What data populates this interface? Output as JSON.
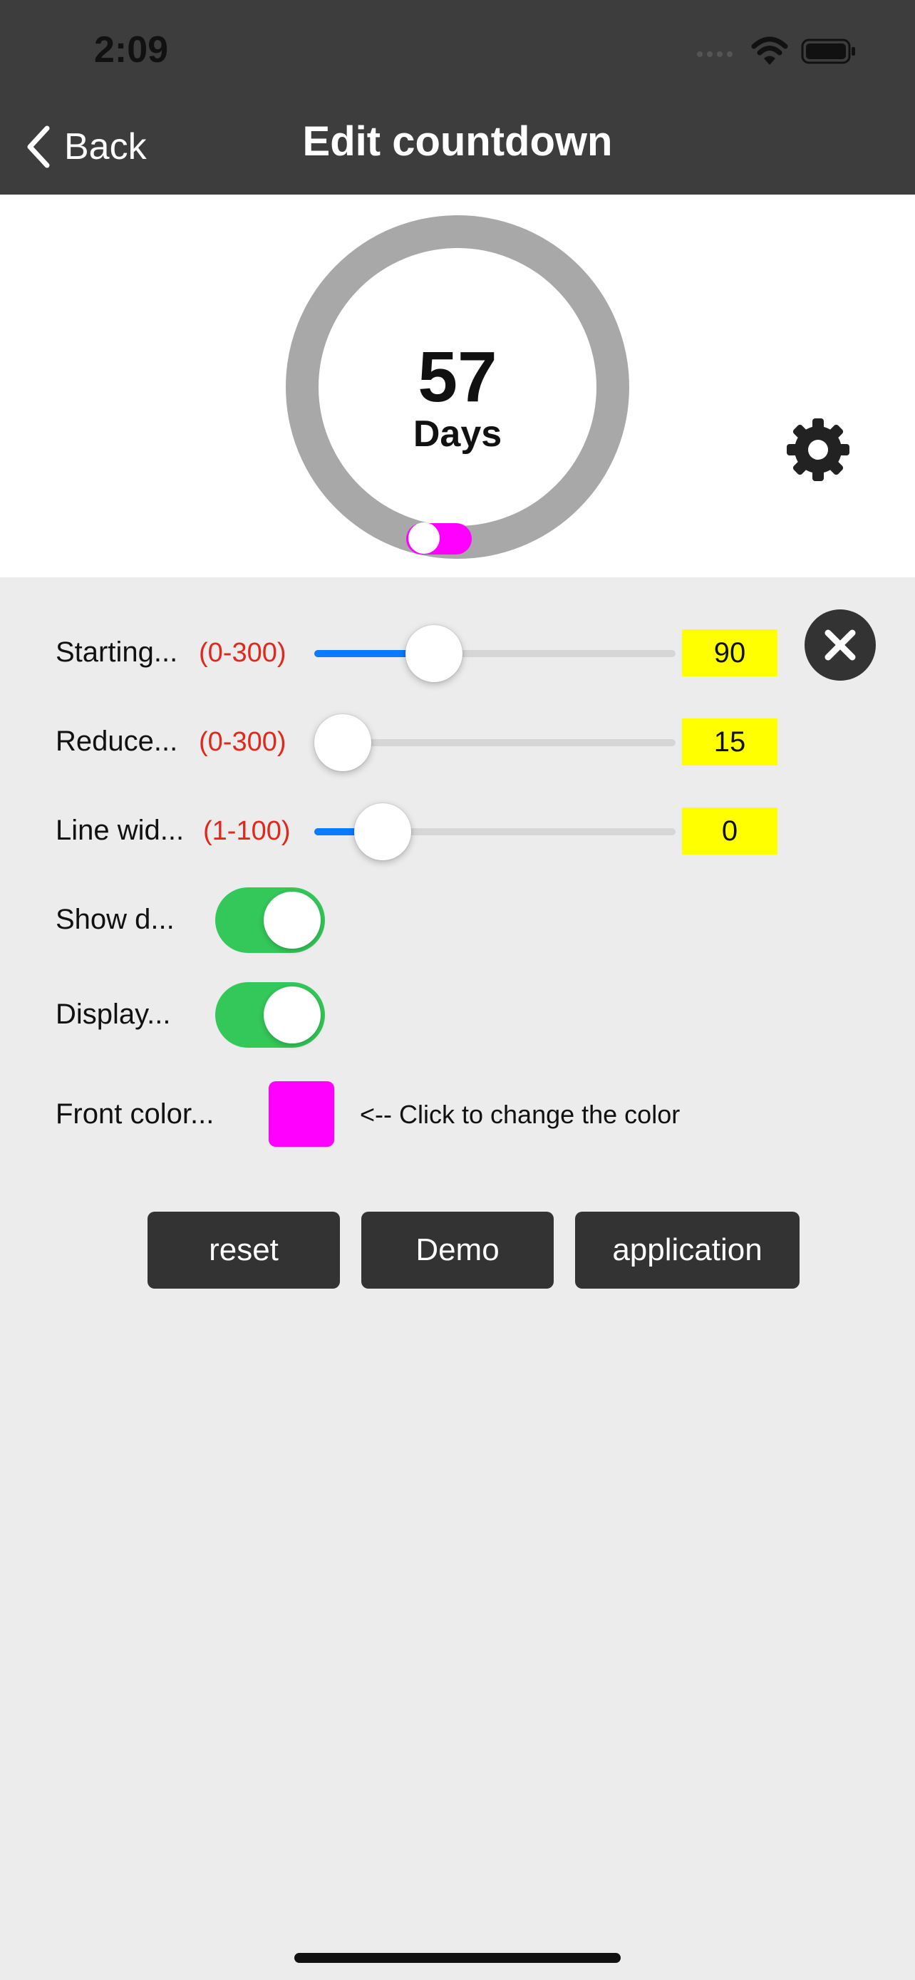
{
  "status_bar": {
    "time": "2:09"
  },
  "nav": {
    "back_label": "Back",
    "title": "Edit countdown"
  },
  "preview": {
    "count": "57",
    "unit": "Days",
    "progress_color": "#ff00ff",
    "ring_color": "#a8a8a8"
  },
  "settings": {
    "sliders": [
      {
        "label": "Starting...",
        "range": "(0-300)",
        "value": "90",
        "fraction": 0.3
      },
      {
        "label": "Reduce...",
        "range": "(0-300)",
        "value": "15",
        "fraction": 0.0
      },
      {
        "label": "Line wid...",
        "range": "(1-100)",
        "value": "0",
        "fraction": 0.13
      }
    ],
    "toggles": [
      {
        "label": "Show d...",
        "on": true
      },
      {
        "label": "Display...",
        "on": true
      }
    ],
    "color": {
      "label": "Front color...",
      "value": "#ff00ff",
      "hint": "<-- Click to change the color"
    }
  },
  "buttons": {
    "reset": "reset",
    "demo": "Demo",
    "apply": "application"
  },
  "colors": {
    "accent": "#0a7aff",
    "toggle_on": "#34c759",
    "value_bg": "#ffff00",
    "range_text": "#e0291c"
  }
}
